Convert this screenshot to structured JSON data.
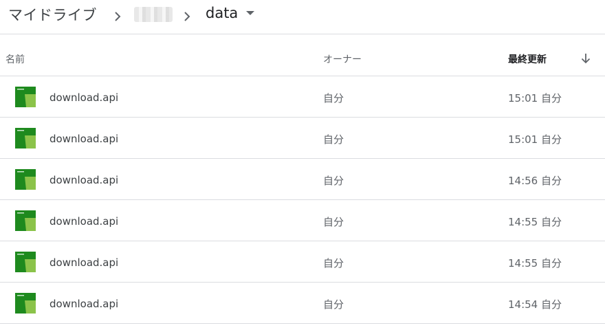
{
  "breadcrumb": {
    "root": "マイドライブ",
    "current": "data"
  },
  "columns": {
    "name": "名前",
    "owner": "オーナー",
    "modified": "最終更新"
  },
  "files": [
    {
      "name": "download.api",
      "owner": "自分",
      "modified": "15:01 自分"
    },
    {
      "name": "download.api",
      "owner": "自分",
      "modified": "15:01 自分"
    },
    {
      "name": "download.api",
      "owner": "自分",
      "modified": "14:56 自分"
    },
    {
      "name": "download.api",
      "owner": "自分",
      "modified": "14:55 自分"
    },
    {
      "name": "download.api",
      "owner": "自分",
      "modified": "14:55 自分"
    },
    {
      "name": "download.api",
      "owner": "自分",
      "modified": "14:54 自分"
    }
  ],
  "colors": {
    "icon_dark": "#1e8a1e",
    "icon_light": "#8bc34a"
  }
}
